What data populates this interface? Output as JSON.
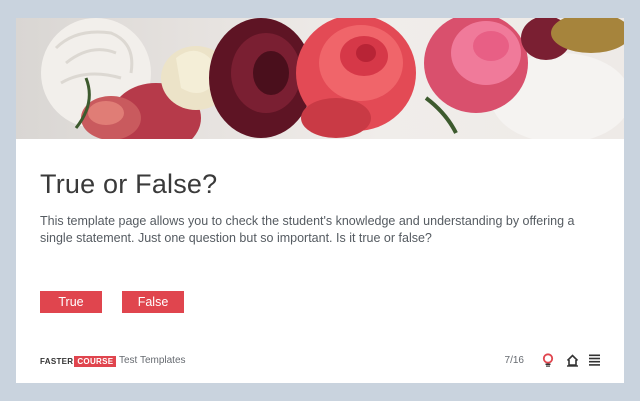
{
  "slide": {
    "title": "True or False?",
    "description": "This template page allows you to check the student's knowledge and understanding by offering a single statement. Just one question but so important. Is it true or false?",
    "answers": [
      {
        "label": "True"
      },
      {
        "label": "False"
      }
    ]
  },
  "footer": {
    "logo_part1": "FASTER",
    "logo_part2": "COURSE",
    "course_name": "Test Templates",
    "page_counter": "7/16",
    "icons": [
      "lightbulb-icon",
      "home-icon",
      "menu-icon"
    ]
  },
  "colors": {
    "accent": "#e0454e",
    "background": "#c9d3de",
    "card": "#ffffff",
    "title_text": "#3a3a3a"
  }
}
